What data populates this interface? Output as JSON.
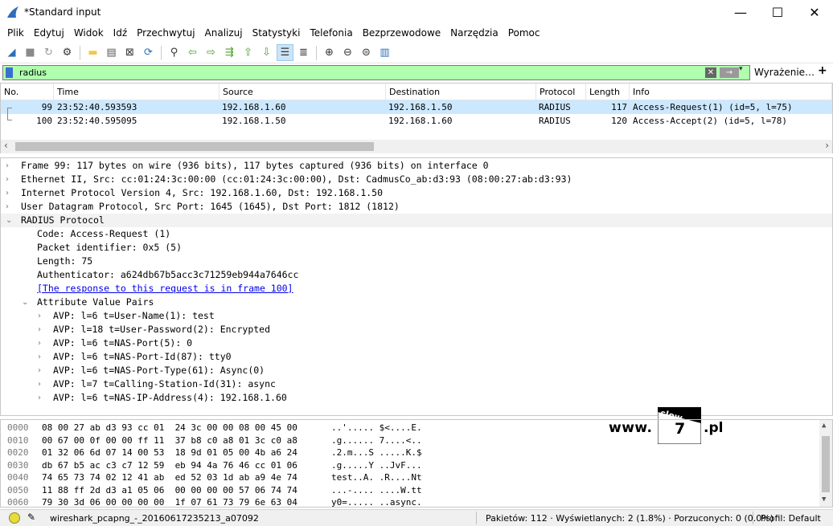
{
  "window": {
    "title": "*Standard input",
    "min": "—",
    "max": "☐",
    "close": "✕"
  },
  "menu": [
    "Plik",
    "Edytuj",
    "Widok",
    "Idź",
    "Przechwytuj",
    "Analizuj",
    "Statystyki",
    "Telefonia",
    "Bezprzewodowe",
    "Narzędzia",
    "Pomoc"
  ],
  "toolbar": [
    {
      "name": "start-capture-icon",
      "glyph": "◢",
      "color": "#2d6fb8"
    },
    {
      "name": "stop-capture-icon",
      "glyph": "■",
      "color": "#8a8a8a"
    },
    {
      "name": "restart-capture-icon",
      "glyph": "↻",
      "color": "#9a9a9a"
    },
    {
      "name": "capture-options-icon",
      "glyph": "⚙",
      "color": "#333333"
    },
    {
      "sep": true
    },
    {
      "name": "open-file-icon",
      "glyph": "▬",
      "color": "#f2c94c"
    },
    {
      "name": "save-file-icon",
      "glyph": "▤",
      "color": "#555555"
    },
    {
      "name": "close-file-icon",
      "glyph": "⊠",
      "color": "#333333"
    },
    {
      "name": "reload-file-icon",
      "glyph": "⟳",
      "color": "#2d6fb8"
    },
    {
      "sep": true
    },
    {
      "name": "find-packet-icon",
      "glyph": "⚲",
      "color": "#333333"
    },
    {
      "name": "go-back-icon",
      "glyph": "⇦",
      "color": "#4a9e2b"
    },
    {
      "name": "go-forward-icon",
      "glyph": "⇨",
      "color": "#4a9e2b"
    },
    {
      "name": "go-to-packet-icon",
      "glyph": "⇶",
      "color": "#4a9e2b"
    },
    {
      "name": "first-packet-icon",
      "glyph": "⇧",
      "color": "#4a9e2b"
    },
    {
      "name": "last-packet-icon",
      "glyph": "⇩",
      "color": "#4a9e2b"
    },
    {
      "name": "autoscroll-icon",
      "glyph": "☰",
      "color": "#333333",
      "active": true
    },
    {
      "name": "colorize-icon",
      "glyph": "≣",
      "color": "#333333"
    },
    {
      "sep": true
    },
    {
      "name": "zoom-in-icon",
      "glyph": "⊕",
      "color": "#333333"
    },
    {
      "name": "zoom-out-icon",
      "glyph": "⊖",
      "color": "#333333"
    },
    {
      "name": "zoom-reset-icon",
      "glyph": "⊜",
      "color": "#333333"
    },
    {
      "name": "resize-columns-icon",
      "glyph": "▥",
      "color": "#2d6fb8"
    }
  ],
  "filter": {
    "value": "radius",
    "expression_label": "Wyrażenie…",
    "clear": "✕",
    "apply": "→",
    "dropdown": "▾",
    "plus": "+"
  },
  "packet_list": {
    "columns": [
      "No.",
      "Time",
      "Source",
      "Destination",
      "Protocol",
      "Length",
      "Info"
    ],
    "rows": [
      {
        "no": "99",
        "time": "23:52:40.593593",
        "src": "192.168.1.60",
        "dst": "192.168.1.50",
        "proto": "RADIUS",
        "len": "117",
        "info": "Access-Request(1) (id=5, l=75)",
        "selected": true
      },
      {
        "no": "100",
        "time": "23:52:40.595095",
        "src": "192.168.1.50",
        "dst": "192.168.1.60",
        "proto": "RADIUS",
        "len": "120",
        "info": "Access-Accept(2) (id=5, l=78)",
        "selected": false
      }
    ],
    "scroll_left": "‹",
    "scroll_right": "›"
  },
  "details": [
    {
      "lvl": 0,
      "arrow": "›",
      "text": "Frame 99: 117 bytes on wire (936 bits), 117 bytes captured (936 bits) on interface 0"
    },
    {
      "lvl": 0,
      "arrow": "›",
      "text": "Ethernet II, Src: cc:01:24:3c:00:00 (cc:01:24:3c:00:00), Dst: CadmusCo_ab:d3:93 (08:00:27:ab:d3:93)"
    },
    {
      "lvl": 0,
      "arrow": "›",
      "text": "Internet Protocol Version 4, Src: 192.168.1.60, Dst: 192.168.1.50"
    },
    {
      "lvl": 0,
      "arrow": "›",
      "text": "User Datagram Protocol, Src Port: 1645 (1645), Dst Port: 1812 (1812)"
    },
    {
      "lvl": 0,
      "arrow": "⌄",
      "text": "RADIUS Protocol",
      "highlight": true
    },
    {
      "lvl": 1,
      "arrow": "",
      "text": "Code: Access-Request (1)"
    },
    {
      "lvl": 1,
      "arrow": "",
      "text": "Packet identifier: 0x5 (5)"
    },
    {
      "lvl": 1,
      "arrow": "",
      "text": "Length: 75"
    },
    {
      "lvl": 1,
      "arrow": "",
      "text": "Authenticator: a624db67b5acc3c71259eb944a7646cc"
    },
    {
      "lvl": 1,
      "arrow": "",
      "text": "[The response to this request is in frame 100]",
      "link": true
    },
    {
      "lvl": 1,
      "arrow": "⌄",
      "text": "Attribute Value Pairs"
    },
    {
      "lvl": 2,
      "arrow": "›",
      "text": "AVP: l=6 t=User-Name(1): test"
    },
    {
      "lvl": 2,
      "arrow": "›",
      "text": "AVP: l=18 t=User-Password(2): Encrypted"
    },
    {
      "lvl": 2,
      "arrow": "›",
      "text": "AVP: l=6 t=NAS-Port(5): 0"
    },
    {
      "lvl": 2,
      "arrow": "›",
      "text": "AVP: l=6 t=NAS-Port-Id(87): tty0"
    },
    {
      "lvl": 2,
      "arrow": "›",
      "text": "AVP: l=6 t=NAS-Port-Type(61): Async(0)"
    },
    {
      "lvl": 2,
      "arrow": "›",
      "text": "AVP: l=7 t=Calling-Station-Id(31): async"
    },
    {
      "lvl": 2,
      "arrow": "›",
      "text": "AVP: l=6 t=NAS-IP-Address(4): 192.168.1.60"
    }
  ],
  "watermark": {
    "www": "www.",
    "slow": "slow",
    "seven": "7",
    "pl": ".pl"
  },
  "hex": [
    {
      "off": "0000",
      "hex": "08 00 27 ab d3 93 cc 01  24 3c 00 00 08 00 45 00",
      "ascii": "..'..... $<....E."
    },
    {
      "off": "0010",
      "hex": "00 67 00 0f 00 00 ff 11  37 b8 c0 a8 01 3c c0 a8",
      "ascii": ".g...... 7....<.."
    },
    {
      "off": "0020",
      "hex": "01 32 06 6d 07 14 00 53  18 9d 01 05 00 4b a6 24",
      "ascii": ".2.m...S .....K.$"
    },
    {
      "off": "0030",
      "hex": "db 67 b5 ac c3 c7 12 59  eb 94 4a 76 46 cc 01 06",
      "ascii": ".g.....Y ..JvF..."
    },
    {
      "off": "0040",
      "hex": "74 65 73 74 02 12 41 ab  ed 52 03 1d ab a9 4e 74",
      "ascii": "test..A. .R....Nt"
    },
    {
      "off": "0050",
      "hex": "11 88 ff 2d d3 a1 05 06  00 00 00 00 57 06 74 74",
      "ascii": "...-.... ....W.tt"
    },
    {
      "off": "0060",
      "hex": "79 30 3d 06 00 00 00 00  1f 07 61 73 79 6e 63 04",
      "ascii": "y0=..... ..async."
    }
  ],
  "status": {
    "file": "wireshark_pcapng_-_20160617235213_a07092",
    "packets": "Pakietów: 112 · Wyświetlanych: 2 (1.8%) · Porzuconych: 0 (0.0%)",
    "profile": "Profil: Default"
  },
  "colors": {
    "filter_ok": "#afffaf",
    "selected_row": "#cce8ff",
    "accent": "#2d6fb8"
  }
}
